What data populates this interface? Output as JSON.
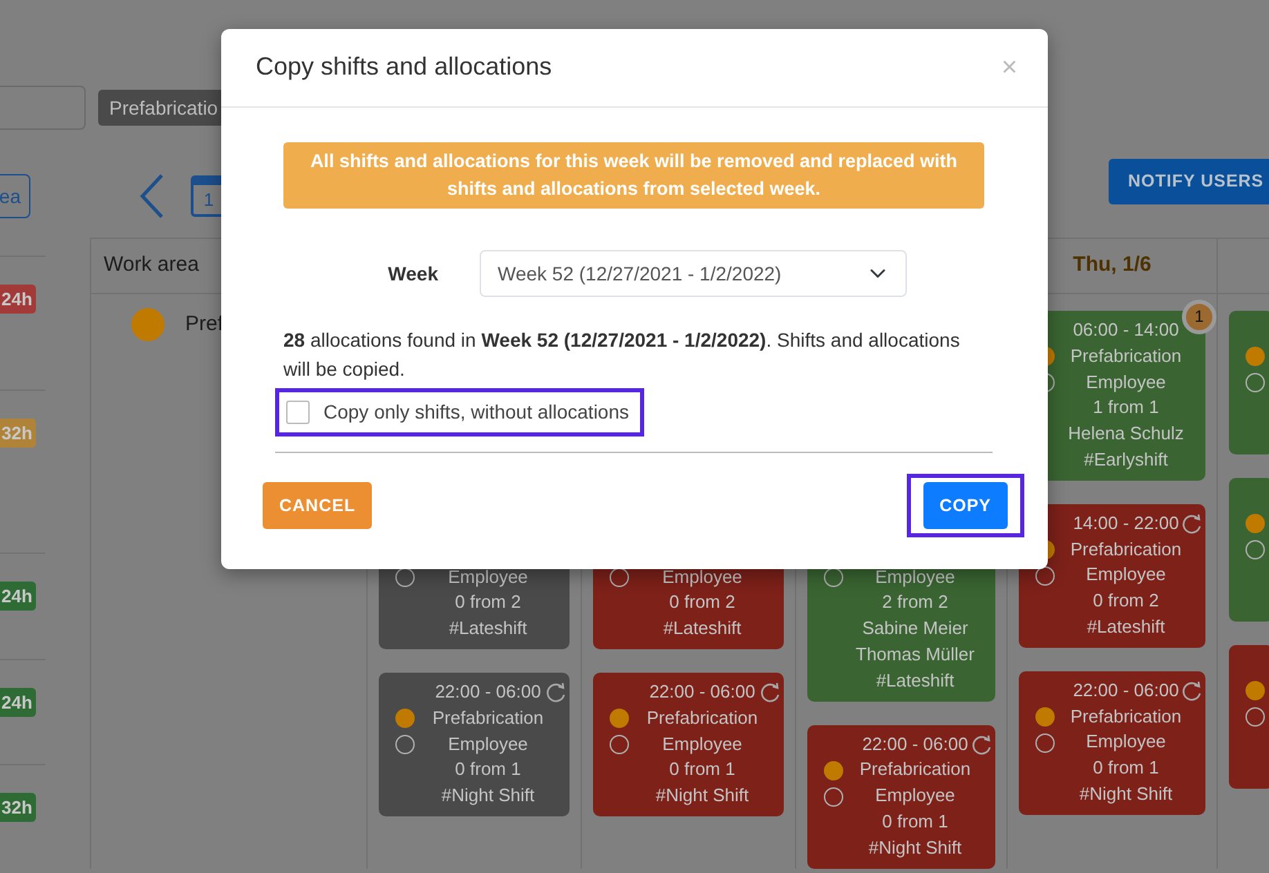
{
  "filter_bar": {
    "tag": "Prefabricatio"
  },
  "view_toolbar": {
    "area_button": "ea",
    "calendar_day": "1",
    "notify_button": "NOTIFY USERS"
  },
  "hour_badges": [
    {
      "text": "24h",
      "color": "#a33a3a"
    },
    {
      "text": "32h",
      "color": "#b08438"
    },
    {
      "text": "24h",
      "color": "#2f6b35"
    },
    {
      "text": "24h",
      "color": "#2f6b35"
    },
    {
      "text": "32h",
      "color": "#2f6b35"
    }
  ],
  "schedule": {
    "work_area_header": "Work area",
    "work_areas": [
      {
        "name": "Pref"
      }
    ],
    "days": [
      {
        "shifts": [
          {
            "color": "#4a4a4a",
            "role": "Employee",
            "count": "0 from 2",
            "tag": "#Lateshift"
          },
          {
            "color": "#4a4a4a",
            "time": "22:00 - 06:00",
            "repeat": true,
            "area": "Prefabrication",
            "role": "Employee",
            "count": "0 from 1",
            "tag": "#Night Shift"
          }
        ]
      },
      {
        "shifts": [
          {
            "color": "#7d2119",
            "role": "Employee",
            "count": "0 from 2",
            "tag": "#Lateshift"
          },
          {
            "color": "#7d2119",
            "time": "22:00 - 06:00",
            "repeat": true,
            "area": "Prefabrication",
            "role": "Employee",
            "count": "0 from 1",
            "tag": "#Night Shift"
          }
        ]
      },
      {
        "shifts": [
          {
            "color": "#3a6532",
            "role": "Employee",
            "count": "2 from 2",
            "people": [
              "Sabine Meier",
              "Thomas Müller"
            ],
            "tag": "#Lateshift"
          },
          {
            "color": "#7d2119",
            "time": "22:00 - 06:00",
            "repeat": true,
            "area": "Prefabrication",
            "role": "Employee",
            "count": "0 from 1",
            "tag": "#Night Shift"
          }
        ]
      },
      {
        "label": "Thu, 1/6",
        "today": true,
        "shifts": [
          {
            "color": "#3a6532",
            "time": "06:00 - 14:00",
            "repeat": false,
            "notifications": "1",
            "area": "Prefabrication",
            "role": "Employee",
            "count": "1 from 1",
            "people": [
              "Helena Schulz"
            ],
            "tag": "#Earlyshift"
          },
          {
            "color": "#7d2119",
            "time": "14:00 - 22:00",
            "repeat": true,
            "area": "Prefabrication",
            "role": "Employee",
            "count": "0 from 2",
            "tag": "#Lateshift"
          },
          {
            "color": "#7d2119",
            "time": "22:00 - 06:00",
            "repeat": true,
            "area": "Prefabrication",
            "role": "Employee",
            "count": "0 from 1",
            "tag": "#Night Shift"
          }
        ]
      },
      {
        "shifts": [
          {
            "color": "#3a6532"
          },
          {
            "color": "#3a6532"
          },
          {
            "color": "#7d2119"
          }
        ]
      }
    ]
  },
  "dialog": {
    "title": "Copy shifts and allocations",
    "close": "×",
    "warning": "All shifts and allocations for this week will be removed and replaced with shifts and allocations from selected week.",
    "week_label": "Week",
    "week_value": "Week 52 (12/27/2021 - 1/2/2022)",
    "summary": "**28** allocations found in **Week 52 (12/27/2021 - 1/2/2022)**. Shifts and allocations will be copied.",
    "option": {
      "label": "Copy only shifts, without allocations",
      "checked": false,
      "highlighted": true
    },
    "buttons": [
      {
        "label": "CANCEL",
        "kind": "cancel",
        "highlighted": false
      },
      {
        "label": "COPY",
        "kind": "primary",
        "highlighted": true
      }
    ]
  }
}
